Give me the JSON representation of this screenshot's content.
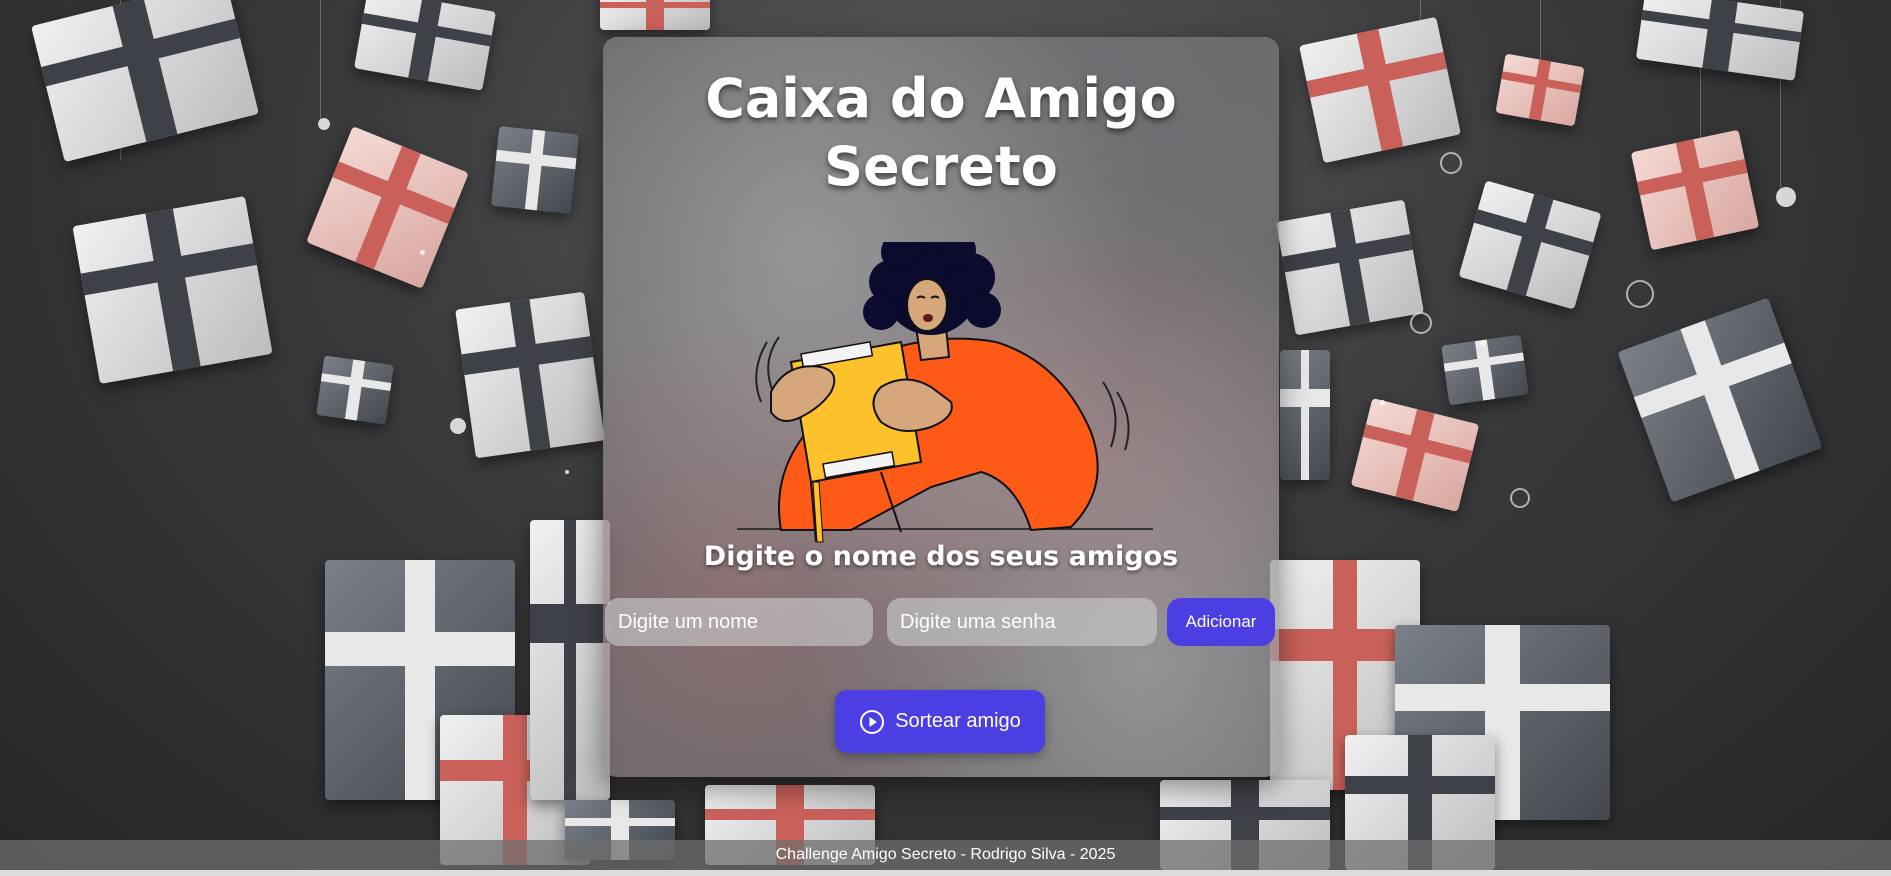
{
  "page": {
    "title": "Caixa do Amigo Secreto",
    "subtitle": "Digite o nome dos seus amigos"
  },
  "form": {
    "name_placeholder": "Digite um nome",
    "name_value": "",
    "password_placeholder": "Digite uma senha",
    "password_value": "",
    "add_label": "Adicionar"
  },
  "actions": {
    "draw_label": "Sortear amigo",
    "draw_icon": "play-circle-icon"
  },
  "footer": {
    "text": "Challenge Amigo Secreto - Rodrigo Silva - 2025"
  },
  "colors": {
    "accent": "#4b3fe3",
    "card_bg": "rgba(150,150,150,0.45)",
    "text": "#ffffff",
    "shirt": "#fe5a17",
    "box": "#fdc22b",
    "hair": "#0b0b2e",
    "skin": "#d6a77a"
  }
}
